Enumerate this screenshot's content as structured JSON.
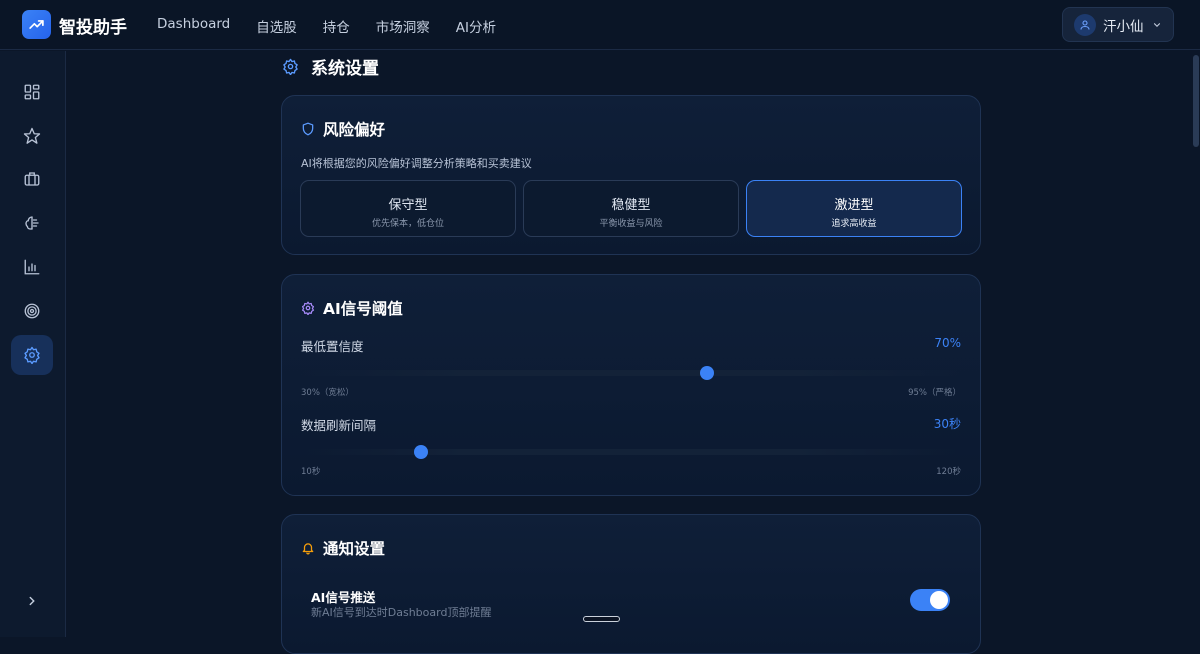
{
  "app": {
    "brand": "智投助手",
    "nav": [
      "Dashboard",
      "自选股",
      "持仓",
      "市场洞察",
      "AI分析"
    ],
    "user": "汗小仙"
  },
  "sidebar": {
    "items": [
      "grid-icon",
      "star-icon",
      "briefcase-icon",
      "brain-icon",
      "bar-chart-icon",
      "target-icon",
      "gear-icon"
    ],
    "active": "gear-icon",
    "expand": "chevron-right-icon"
  },
  "page": {
    "title": "系统设置"
  },
  "risk": {
    "title": "风险偏好",
    "desc": "AI将根据您的风险偏好调整分析策略和买卖建议",
    "options": [
      {
        "name": "保守型",
        "sub": "优先保本，低仓位"
      },
      {
        "name": "稳健型",
        "sub": "平衡收益与风险"
      },
      {
        "name": "激进型",
        "sub": "追求高收益"
      }
    ],
    "selected": "激进型"
  },
  "signal": {
    "title": "AI信号阈值",
    "confidence": {
      "label": "最低置信度",
      "value_text": "70%",
      "value": 70,
      "min": 30,
      "max": 95,
      "min_label": "30%（宽松）",
      "max_label": "95%（严格）"
    },
    "refresh": {
      "label": "数据刷新间隔",
      "value_text": "30秒",
      "value": 30,
      "min": 10,
      "max": 120,
      "min_label": "10秒",
      "max_label": "120秒"
    }
  },
  "notify": {
    "title": "通知设置",
    "push_label": "AI信号推送",
    "push_desc": "新AI信号到达时Dashboard顶部提醒",
    "push_enabled": true
  },
  "colors": {
    "accent": "#3b82f6",
    "background": "#0b1628",
    "warning": "#f59e0b",
    "purple": "#a78bfa"
  }
}
